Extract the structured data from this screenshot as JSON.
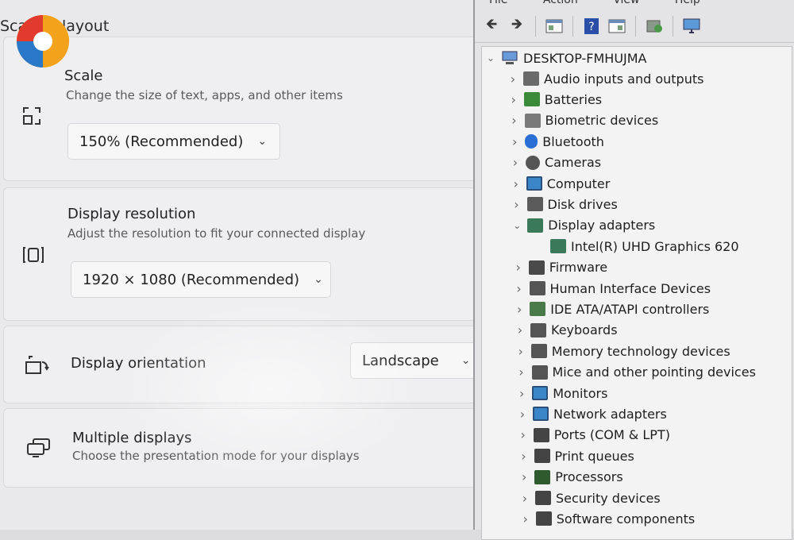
{
  "settings": {
    "section_title": "Scale & layout",
    "scale": {
      "title": "Scale",
      "description": "Change the size of text, apps, and other items",
      "value": "150% (Recommended)",
      "icon": "scale-icon"
    },
    "resolution": {
      "title": "Display resolution",
      "description": "Adjust the resolution to fit your connected display",
      "value": "1920 × 1080 (Recommended)",
      "icon": "resolution-icon"
    },
    "orientation": {
      "title": "Display orientation",
      "value": "Landscape",
      "icon": "orientation-icon"
    },
    "multiple": {
      "title": "Multiple displays",
      "description": "Choose the presentation mode for your displays",
      "icon": "multiple-displays-icon"
    }
  },
  "device_manager": {
    "menu": [
      "File",
      "Action",
      "View",
      "Help"
    ],
    "computer_name": "DESKTOP-FMHUJMA",
    "categories": [
      {
        "label": "Audio inputs and outputs",
        "icon": "speaker-icon",
        "color": "#6a6a6a"
      },
      {
        "label": "Batteries",
        "icon": "battery-icon",
        "color": "#3a8a3a"
      },
      {
        "label": "Biometric devices",
        "icon": "fingerprint-icon",
        "color": "#7a7a7a"
      },
      {
        "label": "Bluetooth",
        "icon": "bluetooth-icon",
        "color": "#2a6fd6"
      },
      {
        "label": "Cameras",
        "icon": "camera-icon",
        "color": "#555555"
      },
      {
        "label": "Computer",
        "icon": "computer-icon",
        "color": "#3a86c8"
      },
      {
        "label": "Disk drives",
        "icon": "disk-icon",
        "color": "#5a5a5a"
      },
      {
        "label": "Display adapters",
        "icon": "display-adapter-icon",
        "color": "#3a7a5a"
      },
      {
        "label": "Intel(R) UHD Graphics 620",
        "icon": "display-adapter-icon",
        "color": "#3a7a5a"
      },
      {
        "label": "Firmware",
        "icon": "firmware-icon",
        "color": "#4a4a4a"
      },
      {
        "label": "Human Interface Devices",
        "icon": "hid-icon",
        "color": "#555555"
      },
      {
        "label": "IDE ATA/ATAPI controllers",
        "icon": "ide-icon",
        "color": "#4a7a4a"
      },
      {
        "label": "Keyboards",
        "icon": "keyboard-icon",
        "color": "#555555"
      },
      {
        "label": "Memory technology devices",
        "icon": "memory-icon",
        "color": "#555555"
      },
      {
        "label": "Mice and other pointing devices",
        "icon": "mouse-icon",
        "color": "#555555"
      },
      {
        "label": "Monitors",
        "icon": "monitor-icon",
        "color": "#3a86c8"
      },
      {
        "label": "Network adapters",
        "icon": "network-icon",
        "color": "#3a86c8"
      },
      {
        "label": "Ports (COM & LPT)",
        "icon": "port-icon",
        "color": "#444444"
      },
      {
        "label": "Print queues",
        "icon": "printer-icon",
        "color": "#444444"
      },
      {
        "label": "Processors",
        "icon": "processor-icon",
        "color": "#2e5a2e"
      },
      {
        "label": "Security devices",
        "icon": "security-icon",
        "color": "#444444"
      },
      {
        "label": "Software components",
        "icon": "software-icon",
        "color": "#444444"
      }
    ]
  }
}
